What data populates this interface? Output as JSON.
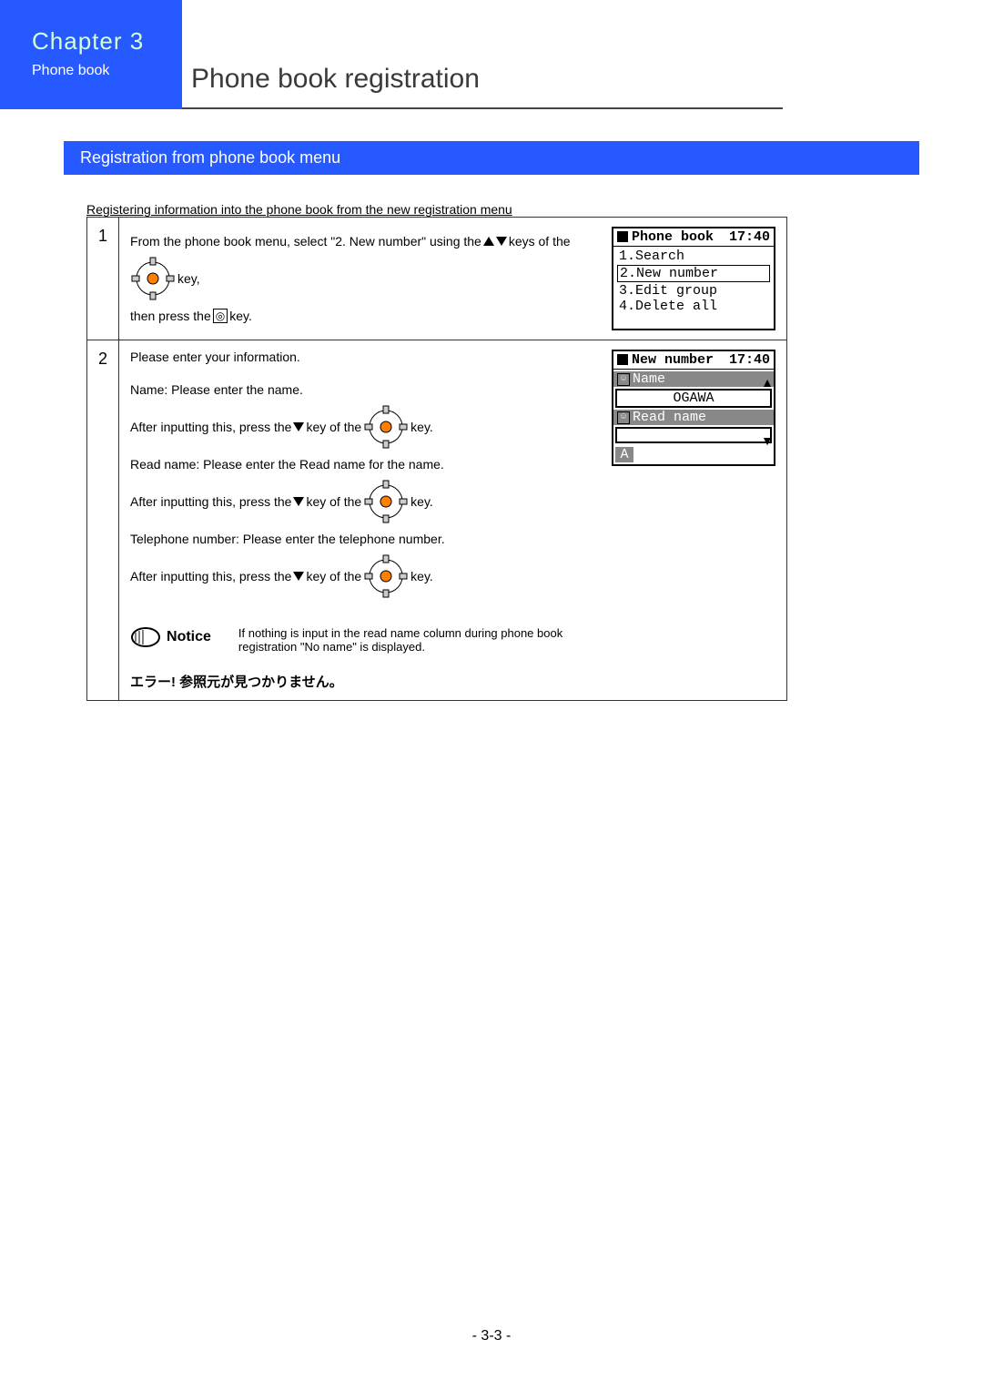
{
  "header": {
    "chapter": "Chapter 3",
    "subchapter": "Phone book",
    "page_title": "Phone book registration"
  },
  "section_bar": "Registration from phone book menu",
  "intro": "Registering information into the phone book from the new registration menu",
  "step1": {
    "num": "1",
    "text_a": "From the phone book menu, select \"2. New number\" using the",
    "text_b": "keys of the",
    "text_c": "key,",
    "text_d": "then press the",
    "text_e": "key."
  },
  "screen1": {
    "title": "Phone book",
    "time": "17:40",
    "items": [
      "1.Search",
      "2.New number",
      "3.Edit group",
      "4.Delete all"
    ]
  },
  "step2": {
    "num": "2",
    "line1": "Please enter your information.",
    "name_label": "Name:  Please enter the name.",
    "after_a": "After inputting this, press the",
    "after_b": "key of the",
    "after_c": "key.",
    "read_label": "Read name:  Please enter the Read name for the name.",
    "tel_label": "Telephone number:  Please enter the telephone number.",
    "notice_title": "Notice",
    "notice_body": "If nothing is input in the read name column during phone book registration \"No name\" is displayed.",
    "error": "エラー! 参照元が見つかりません。"
  },
  "screen2": {
    "title": "New number",
    "time": "17:40",
    "name_label": "Name",
    "name_value": "OGAWA",
    "read_label": "Read name",
    "mode": "A"
  },
  "footer": "- 3-3 -"
}
